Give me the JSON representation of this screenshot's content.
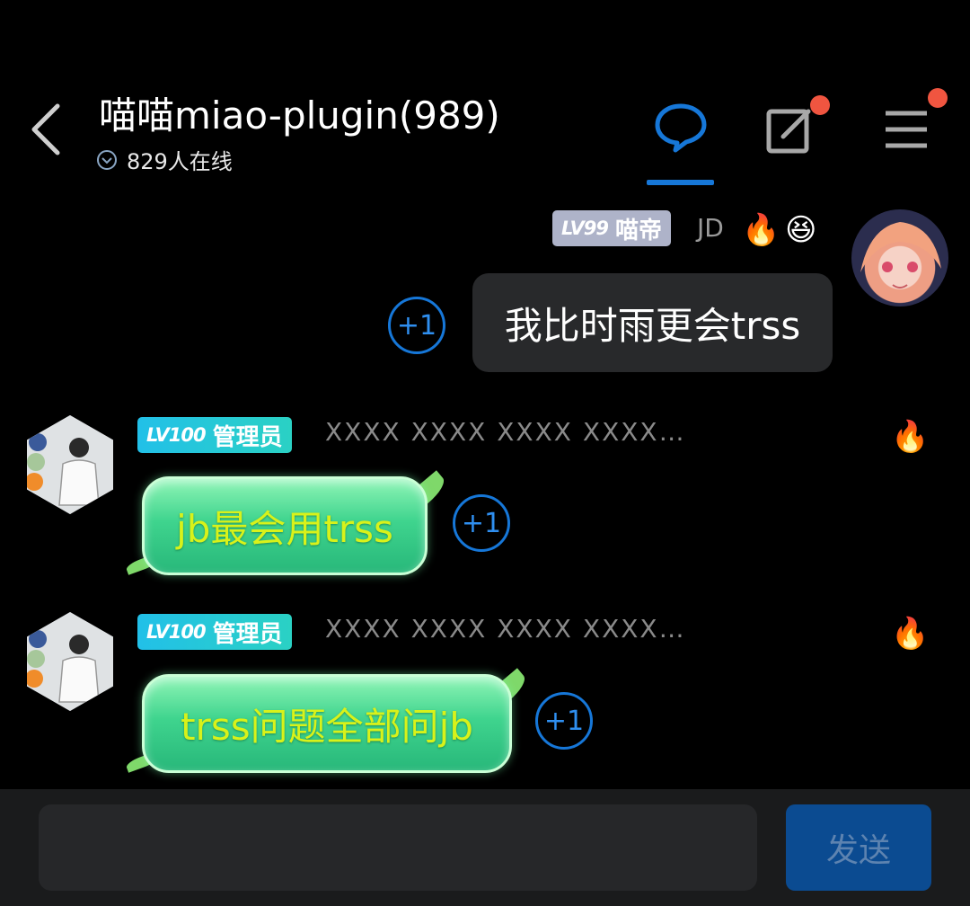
{
  "header": {
    "title": "喵喵miao-plugin(989)",
    "online": "829人在线",
    "icons": {
      "back": "back-chevron-icon",
      "online": "chevron-down-circle-icon",
      "chat": "chat-bubble-icon",
      "edit": "edit-icon",
      "menu": "menu-icon"
    },
    "accent_color": "#1677d8",
    "badge_color": "#f05540"
  },
  "messages": [
    {
      "level": "LV99",
      "title": "喵帝",
      "nickname": "JD",
      "emojis": [
        "🔥",
        "😆"
      ],
      "text": "我比时雨更会trss",
      "plus_one": "+1"
    },
    {
      "level": "LV100",
      "title": "管理员",
      "nickname_masked": "XXXX XXXX XXXX XXXX…",
      "badge": "🔥",
      "text": "jb最会用trss",
      "plus_one": "+1"
    },
    {
      "level": "LV100",
      "title": "管理员",
      "nickname_masked": "XXXX XXXX XXXX XXXX…",
      "badge": "🔥",
      "text": "trss问题全部问jb",
      "plus_one": "+1"
    }
  ],
  "composer": {
    "input_value": "",
    "send_label": "发送"
  }
}
